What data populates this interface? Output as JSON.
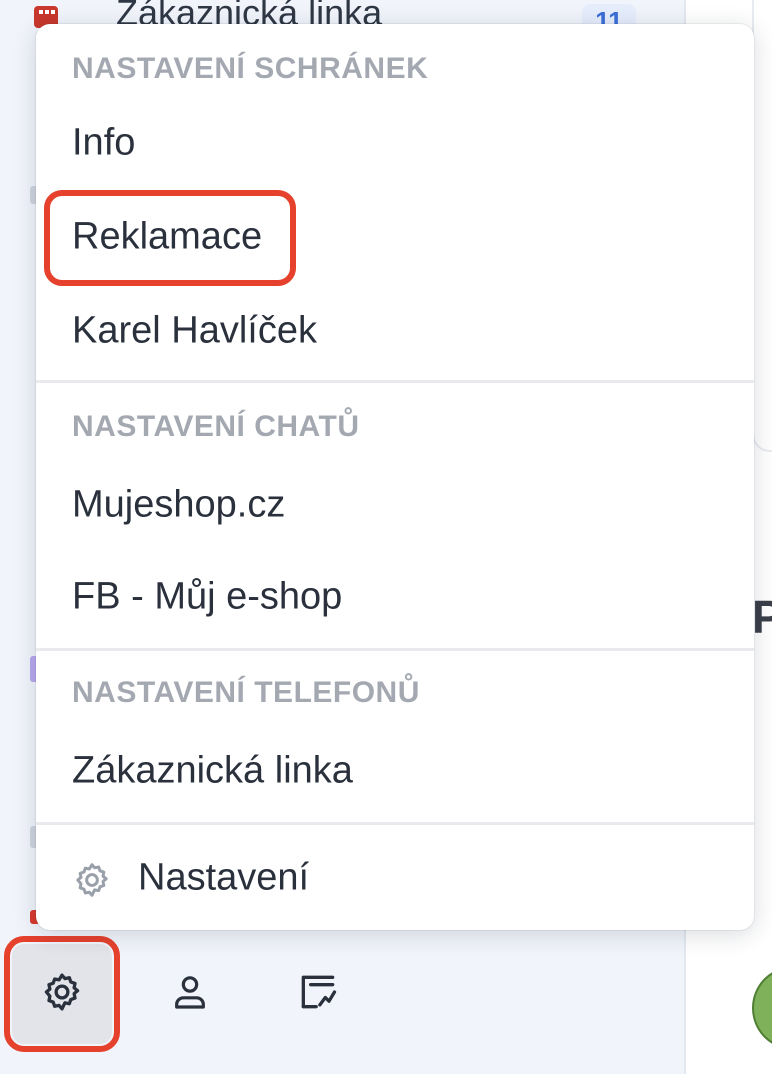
{
  "sidebar": {
    "top_item_label": "Zákaznická linka",
    "top_item_badge": "11"
  },
  "menu": {
    "sections": [
      {
        "header": "NASTAVENÍ SCHRÁNEK",
        "items": [
          "Info",
          "Reklamace",
          "Karel Havlíček"
        ]
      },
      {
        "header": "NASTAVENÍ CHATŮ",
        "items": [
          "Mujeshop.cz",
          "FB - Můj e-shop"
        ]
      },
      {
        "header": "NASTAVENÍ TELEFONŮ",
        "items": [
          "Zákaznická linka"
        ]
      }
    ],
    "settings_label": "Nastavení",
    "highlighted_item": "Reklamace"
  },
  "right_panel": {
    "letter": "P"
  },
  "bottom_bar": {
    "buttons": [
      "gear-icon",
      "user-icon",
      "chart-icon"
    ],
    "active": "gear-icon"
  },
  "colors": {
    "highlight": "#e5412d",
    "sidebar_bg": "#f1f4fb",
    "header_text": "#a3a8b1",
    "item_text": "#2a313d",
    "badge_text": "#3a6fd8"
  }
}
